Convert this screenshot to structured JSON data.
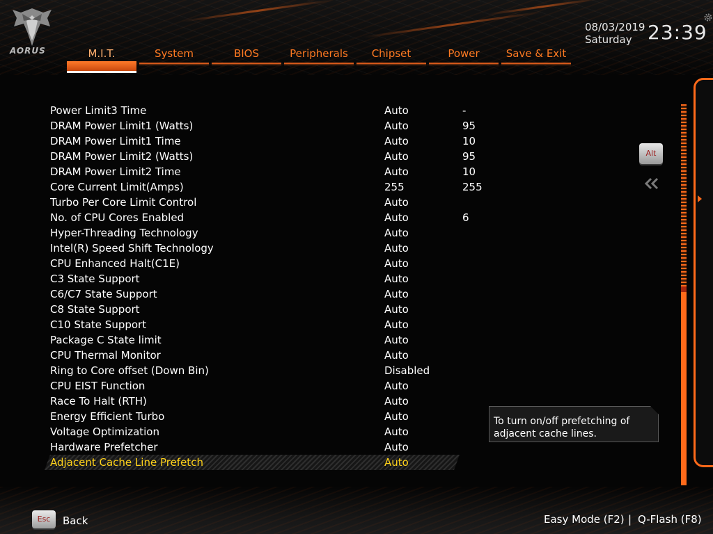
{
  "brand": {
    "logo_text": "AORUS",
    "accent": "#ff6a1a",
    "highlight": "#ffd21a"
  },
  "tabs": [
    {
      "label": "M.I.T.",
      "active": true
    },
    {
      "label": "System"
    },
    {
      "label": "BIOS"
    },
    {
      "label": "Peripherals"
    },
    {
      "label": "Chipset"
    },
    {
      "label": "Power"
    },
    {
      "label": "Save & Exit"
    }
  ],
  "clock": {
    "date": "08/03/2019",
    "day": "Saturday",
    "time": "23:39"
  },
  "settings": [
    {
      "name": "Power Limit3 Time",
      "value": "Auto",
      "current": "-"
    },
    {
      "name": "DRAM Power Limit1 (Watts)",
      "value": "Auto",
      "current": "95"
    },
    {
      "name": "DRAM Power Limit1 Time",
      "value": "Auto",
      "current": "10"
    },
    {
      "name": "DRAM Power Limit2 (Watts)",
      "value": "Auto",
      "current": "95"
    },
    {
      "name": "DRAM Power Limit2 Time",
      "value": "Auto",
      "current": "10"
    },
    {
      "name": "Core Current Limit(Amps)",
      "value": "255",
      "current": "255"
    },
    {
      "name": "Turbo Per Core Limit Control",
      "value": "Auto",
      "current": ""
    },
    {
      "name": "No. of CPU Cores Enabled",
      "value": "Auto",
      "current": "6"
    },
    {
      "name": "Hyper-Threading Technology",
      "value": "Auto",
      "current": ""
    },
    {
      "name": "Intel(R) Speed Shift Technology",
      "value": "Auto",
      "current": ""
    },
    {
      "name": "CPU Enhanced Halt(C1E)",
      "value": "Auto",
      "current": ""
    },
    {
      "name": "C3 State Support",
      "value": "Auto",
      "current": ""
    },
    {
      "name": "C6/C7 State Support",
      "value": "Auto",
      "current": ""
    },
    {
      "name": "C8 State Support",
      "value": "Auto",
      "current": ""
    },
    {
      "name": "C10 State Support",
      "value": "Auto",
      "current": ""
    },
    {
      "name": "Package C State limit",
      "value": "Auto",
      "current": ""
    },
    {
      "name": "CPU Thermal Monitor",
      "value": "Auto",
      "current": ""
    },
    {
      "name": "Ring to Core offset (Down Bin)",
      "value": "Disabled",
      "current": ""
    },
    {
      "name": "CPU EIST Function",
      "value": "Auto",
      "current": ""
    },
    {
      "name": "Race To Halt (RTH)",
      "value": "Auto",
      "current": ""
    },
    {
      "name": "Energy Efficient Turbo",
      "value": "Auto",
      "current": ""
    },
    {
      "name": "Voltage Optimization",
      "value": "Auto",
      "current": ""
    },
    {
      "name": "Hardware Prefetcher",
      "value": "Auto",
      "current": ""
    },
    {
      "name": "Adjacent Cache Line Prefetch",
      "value": "Auto",
      "current": "",
      "selected": true
    }
  ],
  "side": {
    "alt_label": "Alt"
  },
  "help": {
    "text_line1": "To turn on/off prefetching of",
    "text_line2": "adjacent cache lines."
  },
  "footer": {
    "esc_label": "Esc",
    "back_label": "Back",
    "easy_mode": "Easy Mode (F2)",
    "separator": "|",
    "qflash": "Q-Flash (F8)"
  }
}
